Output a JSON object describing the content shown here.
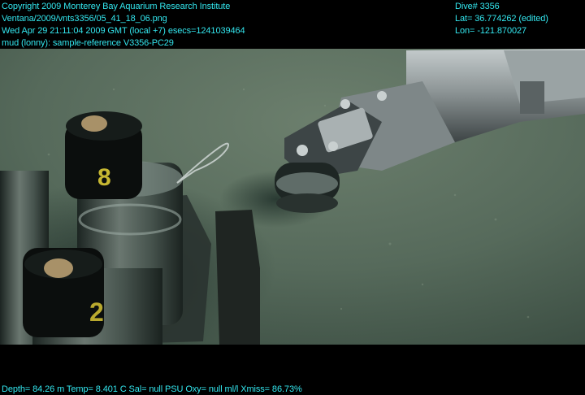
{
  "overlay": {
    "copyright": "Copyright 2009 Monterey Bay Aquarium Research Institute",
    "file": "Ventana/2009/vnts3356/05_41_18_06.png",
    "time": "Wed Apr 29 21:11:04 2009 GMT (local +7)  esecs=1241039464",
    "annotation": "mud (lonny): sample-reference V3356-PC29",
    "dive": "Dive# 3356",
    "lat": "Lat= 36.774262 (edited)",
    "lon": "Lon= -121.870027",
    "sensors": "Depth= 84.26 m  Temp= 8.401 C  Sal= null PSU  Oxy= null ml/l  Xmiss= 86.73%"
  },
  "core_labels": [
    "8",
    "2"
  ],
  "colors": {
    "overlay_text": "#33e6ee",
    "seafloor": "#55685a",
    "background": "#000000"
  }
}
